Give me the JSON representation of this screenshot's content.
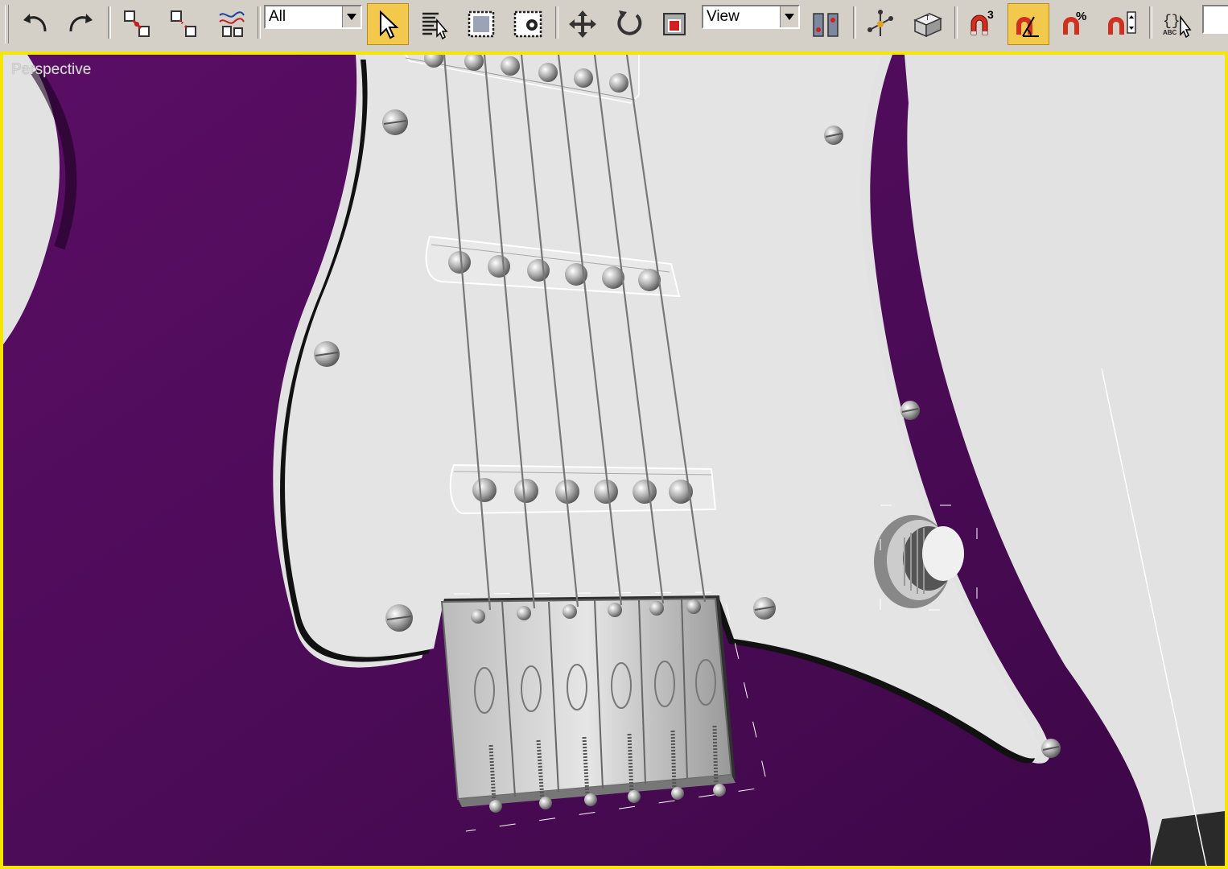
{
  "toolbar": {
    "buttons": [
      {
        "name": "undo-button",
        "icon": "undo-icon"
      },
      {
        "name": "redo-button",
        "icon": "redo-icon"
      },
      {
        "name": "select-and-link-button",
        "icon": "link-icon"
      },
      {
        "name": "unlink-selection-button",
        "icon": "unlink-icon"
      },
      {
        "name": "bind-to-space-warp-button",
        "icon": "space-warp-icon"
      },
      {
        "name": "select-object-button",
        "icon": "arrow-cursor-icon",
        "active": true
      },
      {
        "name": "select-by-name-button",
        "icon": "select-by-name-icon"
      },
      {
        "name": "rectangular-selection-button",
        "icon": "rect-selection-icon"
      },
      {
        "name": "window-crossing-button",
        "icon": "window-crossing-icon"
      },
      {
        "name": "select-and-move-button",
        "icon": "move-icon"
      },
      {
        "name": "select-and-rotate-button",
        "icon": "rotate-icon"
      },
      {
        "name": "select-and-scale-button",
        "icon": "scale-icon"
      },
      {
        "name": "use-pivot-point-center-button",
        "icon": "pivot-center-icon"
      },
      {
        "name": "select-and-manipulate-button",
        "icon": "manipulate-icon"
      },
      {
        "name": "keyboard-shortcut-override-button",
        "icon": "keyboard-icon"
      },
      {
        "name": "snaps-toggle-button",
        "icon": "snap-magnet-icon"
      },
      {
        "name": "angle-snap-toggle-button",
        "icon": "angle-snap-icon",
        "active": true
      },
      {
        "name": "percent-snap-toggle-button",
        "icon": "percent-snap-icon"
      },
      {
        "name": "spinner-snap-toggle-button",
        "icon": "spinner-snap-icon"
      },
      {
        "name": "edit-named-selection-sets-button",
        "icon": "named-selection-icon"
      }
    ],
    "selection_filter": {
      "value": "All"
    },
    "reference_coordinate_system": {
      "value": "View"
    },
    "snap_dimension": "3",
    "percent_symbol": "%",
    "named_sets_label": "ABC"
  },
  "viewport": {
    "label": "Perspective",
    "border_color": "#f5e500",
    "body_color": "#4d0a55",
    "pickguard_color": "#e4e4e4"
  }
}
